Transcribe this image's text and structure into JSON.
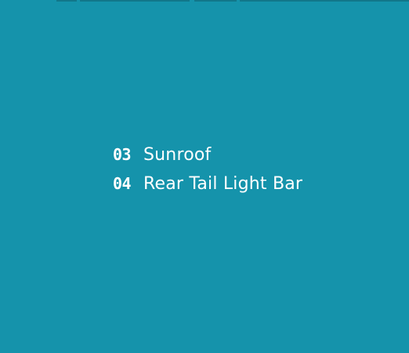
{
  "colors": {
    "background": "#1593ab",
    "text": "#ffffff"
  },
  "features": [
    {
      "index": "03",
      "label": "Sunroof"
    },
    {
      "index": "04",
      "label": "Rear Tail Light Bar"
    }
  ]
}
